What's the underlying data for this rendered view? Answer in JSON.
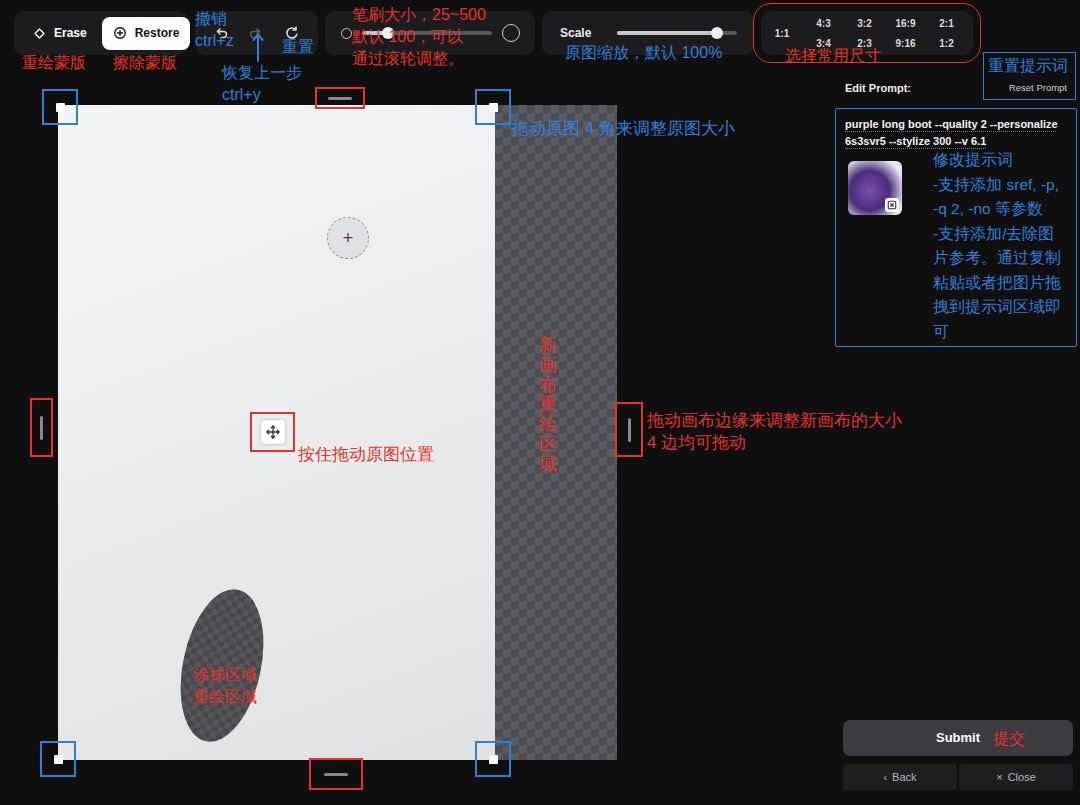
{
  "toolbar": {
    "mask_tools": [
      {
        "label": "Erase",
        "kind": "erase",
        "selected": false
      },
      {
        "label": "Restore",
        "kind": "restore",
        "selected": true
      }
    ],
    "history": [
      {
        "kind": "undo",
        "disabled": false
      },
      {
        "kind": "redo",
        "disabled": true
      },
      {
        "kind": "reset",
        "disabled": false
      }
    ],
    "brush_size": {
      "level": 0.2
    },
    "scale": {
      "label": "Scale",
      "level": 0.83
    },
    "aspect_ratios": [
      {
        "label": "1:1",
        "selected": false
      },
      {
        "label": "4:3",
        "selected": false
      },
      {
        "label": "3:2",
        "selected": false
      },
      {
        "label": "16:9",
        "selected": false
      },
      {
        "label": "2:1",
        "selected": false
      },
      {
        "label": "3:4",
        "selected": false
      },
      {
        "label": "2:3",
        "selected": false
      },
      {
        "label": "9:16",
        "selected": false
      },
      {
        "label": "1:2",
        "selected": false
      }
    ],
    "aspect_outline_color": "#e5322a"
  },
  "canvas": {
    "mask_painted": true,
    "brush_cursor": "+",
    "move_handle": {
      "color": "#e5322a"
    },
    "handles": [
      {
        "kind": "corner",
        "color": "#2f7fd9"
      },
      {
        "kind": "corner",
        "color": "#2f7fd9"
      },
      {
        "kind": "corner",
        "color": "#2f7fd9"
      },
      {
        "kind": "corner",
        "color": "#2f7fd9"
      },
      {
        "kind": "edge",
        "color": "#e5322a"
      },
      {
        "kind": "edge",
        "color": "#e5322a"
      },
      {
        "kind": "edge",
        "color": "#e5322a"
      },
      {
        "kind": "edge",
        "color": "#e5322a"
      }
    ]
  },
  "prompt": {
    "label": "Edit Prompt:",
    "reset": "Reset Prompt",
    "text": "purple long boot --quality 2 --personalize 6s3svr5 --stylize 300 --v 6.1",
    "outline_color": "#2f7fd9",
    "image_refs": [
      {
        "removable": true
      }
    ]
  },
  "actions": {
    "submit": "Submit",
    "back": {
      "icon": "‹",
      "label": "Back"
    },
    "close": {
      "icon": "×",
      "label": "Close"
    }
  },
  "annotations": [
    {
      "text": "重绘蒙版",
      "color": "#e5322a",
      "kind": "horizontal",
      "arrow": false,
      "outline": false
    },
    {
      "text": "擦除蒙版",
      "color": "#e5322a",
      "kind": "horizontal",
      "arrow": false,
      "outline": false
    },
    {
      "text": "撤销\nctrl+z",
      "color": "#2f7fd9",
      "kind": "horizontal",
      "arrow": false,
      "outline": false
    },
    {
      "text": "恢复上一步\nctrl+y",
      "color": "#2f7fd9",
      "kind": "horizontal",
      "arrow": true,
      "outline": false
    },
    {
      "text": "重置",
      "color": "#2f7fd9",
      "kind": "horizontal",
      "arrow": false,
      "outline": false
    },
    {
      "text": "笔刷大小，25~500\n默认 100，可以\n通过滚轮调整。",
      "color": "#e5322a",
      "kind": "horizontal",
      "arrow": false,
      "outline": false
    },
    {
      "text": "原图缩放，默认 100%",
      "color": "#2f7fd9",
      "kind": "horizontal",
      "arrow": false,
      "outline": false
    },
    {
      "text": "选择常用尺寸",
      "color": "#e5322a",
      "kind": "horizontal",
      "arrow": false,
      "outline": false
    },
    {
      "text": "重置提示词",
      "color": "#2f7fd9",
      "kind": "horizontal",
      "arrow": false,
      "outline": true
    },
    {
      "text": "拖动原图 4 角来调整原图大小",
      "color": "#2f7fd9",
      "kind": "horizontal",
      "arrow": false,
      "outline": false
    },
    {
      "text": "修改提示词\n-支持添加 sref, -p,\n-q 2, -no 等参数\n-支持添加/去除图\n片参考。通过复制\n粘贴或者把图片拖\n拽到提示词区域即\n可",
      "color": "#2f7fd9",
      "kind": "horizontal",
      "arrow": false,
      "outline": false
    },
    {
      "text": "新画布重绘区域",
      "color": "#e5322a",
      "kind": "vertical",
      "arrow": false,
      "outline": false
    },
    {
      "text": "拖动画布边缘来调整新画布的大小\n4 边均可拖动",
      "color": "#e5322a",
      "kind": "horizontal",
      "arrow": false,
      "outline": false
    },
    {
      "text": "按住拖动原图位置",
      "color": "#e5322a",
      "kind": "horizontal",
      "arrow": false,
      "outline": false
    },
    {
      "text": "涂抹区域\n重绘区域",
      "color": "#e5322a",
      "kind": "horizontal",
      "arrow": false,
      "outline": false
    },
    {
      "text": "提交",
      "color": "#e5322a",
      "kind": "horizontal",
      "arrow": false,
      "outline": false
    }
  ]
}
